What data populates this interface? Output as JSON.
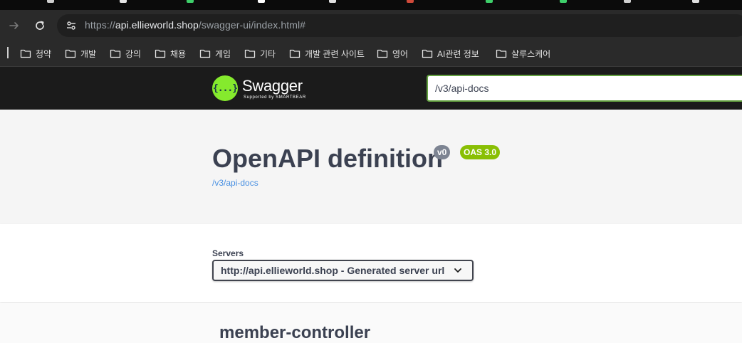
{
  "browser": {
    "url_prefix": "https://",
    "url_host": "api.ellieworld.shop",
    "url_path": "/swagger-ui/index.html#",
    "bookmarks": [
      "청약",
      "개발",
      "강의",
      "채용",
      "게임",
      "기타",
      "개발 관련 사이트",
      "영어",
      "AI관련 정보",
      "살루스케어"
    ]
  },
  "swagger": {
    "logo_text": "Swagger",
    "logo_glyph": "{...}",
    "logo_sub": "Supported by SMARTBEAR",
    "spec_url_value": "/v3/api-docs",
    "title": "OpenAPI definition",
    "version_badge": "v0",
    "oas_badge": "OAS 3.0",
    "spec_link": "/v3/api-docs",
    "servers_label": "Servers",
    "server_selected": "http://api.ellieworld.shop - Generated server url",
    "first_tag": "member-controller"
  },
  "colors": {
    "swagger_green": "#85ea2d",
    "oas_badge": "#89bf04",
    "version_badge": "#7d8492",
    "link_blue": "#4990e2",
    "text_dark": "#3b4151"
  }
}
